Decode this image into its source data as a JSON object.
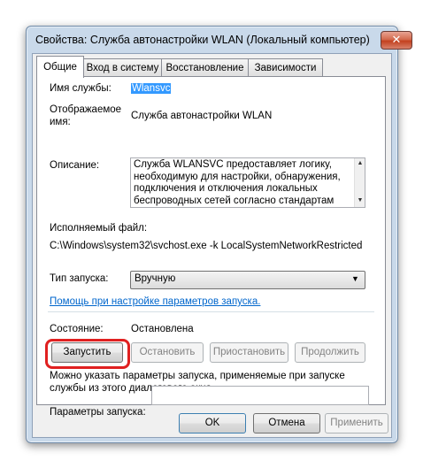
{
  "window": {
    "title": "Свойства: Служба автонастройки WLAN (Локальный компьютер)",
    "close_glyph": "✕"
  },
  "tabs": [
    {
      "label": "Общие"
    },
    {
      "label": "Вход в систему"
    },
    {
      "label": "Восстановление"
    },
    {
      "label": "Зависимости"
    }
  ],
  "general": {
    "service_name_label": "Имя службы:",
    "service_name_value": "Wlansvc",
    "display_name_label_line1": "Отображаемое",
    "display_name_label_line2": "имя:",
    "display_name_value": "Служба автонастройки WLAN",
    "description_label": "Описание:",
    "description_lines": [
      "Служба WLANSVC предоставляет логику,",
      "необходимую для настройки, обнаружения,",
      "подключения и отключения локальных",
      "беспроводных сетей согласно стандартам IEEE"
    ],
    "exe_label": "Исполняемый файл:",
    "exe_path": "C:\\Windows\\system32\\svchost.exe -k LocalSystemNetworkRestricted",
    "startup_type_label": "Тип запуска:",
    "startup_type_value": "Вручную",
    "help_link": "Помощь при настройке параметров запуска.",
    "status_label": "Состояние:",
    "status_value": "Остановлена",
    "start_button": "Запустить",
    "stop_button": "Остановить",
    "pause_button": "Приостановить",
    "resume_button": "Продолжить",
    "hint_line1": "Можно указать параметры запуска, применяемые при запуске",
    "hint_line2": "службы из этого диалогового окна.",
    "params_label": "Параметры запуска:",
    "params_value": ""
  },
  "footer": {
    "ok": "OK",
    "cancel": "Отмена",
    "apply": "Применить"
  },
  "colors": {
    "highlight": "#e02020",
    "link": "#0066cc",
    "selection": "#3399ff"
  }
}
